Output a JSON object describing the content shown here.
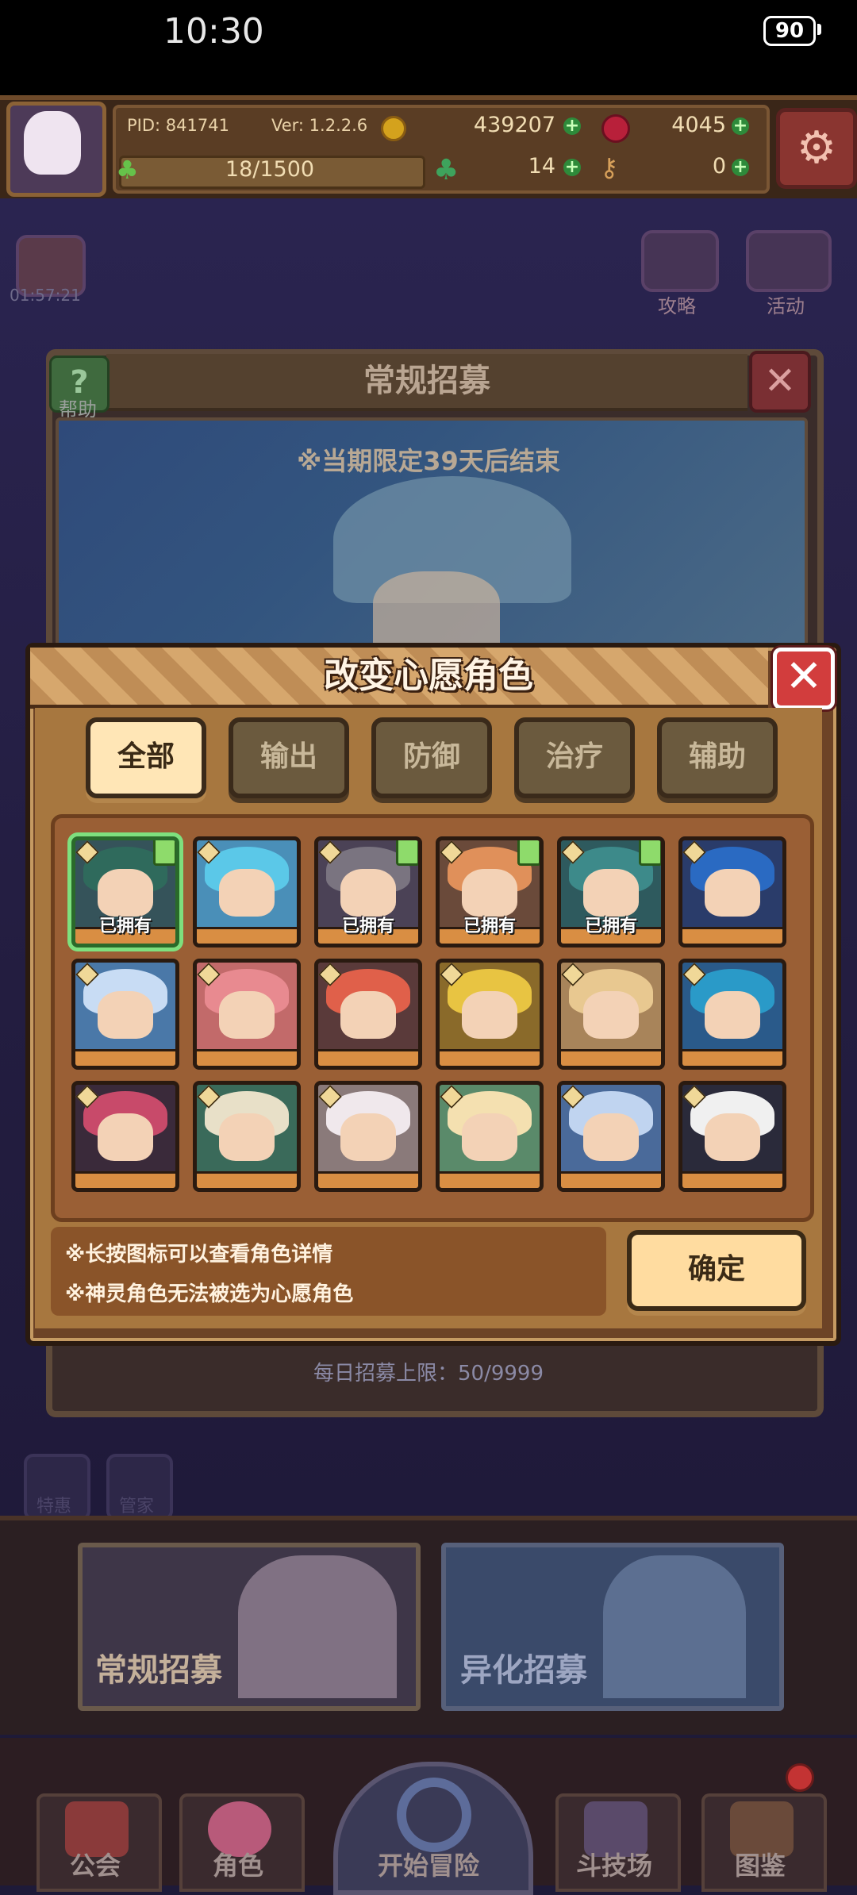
{
  "status_bar": {
    "time": "10:30",
    "battery": "90"
  },
  "player": {
    "pid": "PID: 841741",
    "version": "Ver: 1.2.2.6",
    "gold": "439207",
    "gems": "4045",
    "stamina": "18/1500",
    "clover": "14",
    "keys": "0"
  },
  "background": {
    "timer": "01:57:21",
    "guide_label": "攻略",
    "event_label": "活动",
    "help_label": "帮助",
    "recruit_title": "常规招募",
    "banner_note": "※当期限定39天后结束",
    "daily_limit": "每日招募上限：50/9999",
    "side_btn_1": "特惠",
    "side_btn_2": "管家",
    "regular_recruit": "常规招募",
    "alien_recruit": "异化招募"
  },
  "nav": {
    "guild": "公会",
    "characters": "角色",
    "adventure": "开始冒险",
    "arena": "斗技场",
    "codex": "图鉴"
  },
  "modal": {
    "title": "改变心愿角色",
    "tabs": [
      "全部",
      "输出",
      "防御",
      "治疗",
      "辅助"
    ],
    "active_tab": "全部",
    "owned_label": "已拥有",
    "characters": [
      {
        "owned": true,
        "selected": true,
        "hair": "#2f6a5c",
        "bg": "#35535a"
      },
      {
        "owned": false,
        "selected": false,
        "hair": "#5bc8e8",
        "bg": "#4a8fb8"
      },
      {
        "owned": true,
        "selected": false,
        "hair": "#7a7480",
        "bg": "#4b4256"
      },
      {
        "owned": true,
        "selected": false,
        "hair": "#e0905a",
        "bg": "#6a4a3a"
      },
      {
        "owned": true,
        "selected": false,
        "hair": "#3d8a8a",
        "bg": "#2e5a5e"
      },
      {
        "owned": false,
        "selected": false,
        "hair": "#2a6ac2",
        "bg": "#2a3c6a"
      },
      {
        "owned": false,
        "selected": false,
        "hair": "#c8dcf4",
        "bg": "#4a78a8"
      },
      {
        "owned": false,
        "selected": false,
        "hair": "#e88a90",
        "bg": "#c26a6a"
      },
      {
        "owned": false,
        "selected": false,
        "hair": "#e0604a",
        "bg": "#5a3a3a"
      },
      {
        "owned": false,
        "selected": false,
        "hair": "#e8c442",
        "bg": "#8a6a2a"
      },
      {
        "owned": false,
        "selected": false,
        "hair": "#e8c890",
        "bg": "#a8845a"
      },
      {
        "owned": false,
        "selected": false,
        "hair": "#2a9ac8",
        "bg": "#2a5a8a"
      },
      {
        "owned": false,
        "selected": false,
        "hair": "#c84a6a",
        "bg": "#3a2a3a"
      },
      {
        "owned": false,
        "selected": false,
        "hair": "#e8e0c8",
        "bg": "#3a6a5a"
      },
      {
        "owned": false,
        "selected": false,
        "hair": "#f0e8ec",
        "bg": "#8a7a7a"
      },
      {
        "owned": false,
        "selected": false,
        "hair": "#f4e0b0",
        "bg": "#5a8a6a"
      },
      {
        "owned": false,
        "selected": false,
        "hair": "#c0d4f0",
        "bg": "#4a6a9a"
      },
      {
        "owned": false,
        "selected": false,
        "hair": "#f0f0f0",
        "bg": "#2a2a3a"
      }
    ],
    "tip_1": "※长按图标可以查看角色详情",
    "tip_2": "※神灵角色无法被选为心愿角色",
    "confirm": "确定"
  },
  "colors": {
    "owned_highlight": "#7ee07e",
    "close_red": "#d23d3d",
    "panel_brown": "#a7773f"
  }
}
